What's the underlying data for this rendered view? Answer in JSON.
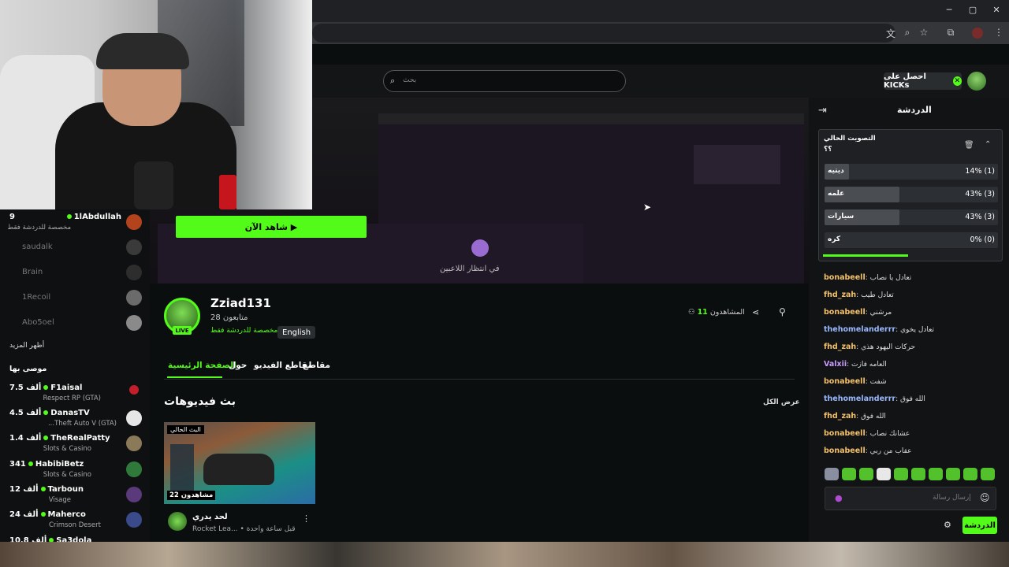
{
  "browser": {
    "min_icon": "─",
    "max_icon": "▢",
    "close_icon": "✕",
    "toolbar_icons": [
      "translate-icon",
      "zoom-icon",
      "star-icon",
      "extensions-icon",
      "menu-icon"
    ]
  },
  "header": {
    "search_placeholder": "بحث",
    "get_kicks": "احصل على KICKs"
  },
  "sidebar": {
    "top_channel": {
      "name": "1lAbdullah",
      "views": "9",
      "category": "مخصصة للدردشة فقط"
    },
    "offline": [
      "saudalk",
      "Brain",
      "1Recoil",
      "Abo5oel"
    ],
    "show_more": "أظهر المزيد",
    "recommended_heading": "موصى بها",
    "recommended": [
      {
        "name": "F1aisal",
        "views": "7.5 ألف",
        "category": "Respect RP (GTA)"
      },
      {
        "name": "DanasTV",
        "views": "4.5 ألف",
        "category": "...Theft Auto V (GTA)"
      },
      {
        "name": "TheRealPatty",
        "views": "1.4 ألف",
        "category": "Slots & Casino"
      },
      {
        "name": "HabibiBetz",
        "views": "341",
        "category": "Slots & Casino"
      },
      {
        "name": "Tarboun",
        "views": "12 ألف",
        "category": "Visage"
      },
      {
        "name": "Maherco",
        "views": "24 ألف",
        "category": "Crimson Desert"
      },
      {
        "name": "Sa3dola",
        "views": "10.8 ألف",
        "category": ""
      }
    ]
  },
  "player": {
    "watch_now": "شاهد الآن ▶",
    "overlay_text": "في انتظار اللاعبين"
  },
  "channel": {
    "name": "Zziad131",
    "followers": "متابعون 28",
    "category": "مخصصة للدردشة فقط",
    "language": "English",
    "live": "LIVE",
    "viewers_label": "المشاهدون",
    "viewers_count": "11"
  },
  "tabs": [
    "الصفحة الرئيسية",
    "حول",
    "مقاطع الفيديو",
    "مقاطع"
  ],
  "vods": {
    "title": "بث فيديوهات",
    "show_all": "عرض الكل",
    "item": {
      "badge": "البث الحالي",
      "views": "مشاهدون 22",
      "title": "لحد يدري",
      "subtitle": "Rocket Lea... • قبل ساعة واحدة"
    }
  },
  "chat": {
    "title": "الدردشة",
    "poll": {
      "title": "التصويت الحالي",
      "question": "؟؟",
      "options": [
        {
          "label": "ديتيه",
          "value": "14% (1)",
          "fill": 0.14
        },
        {
          "label": "علمه",
          "value": "43% (3)",
          "fill": 0.43
        },
        {
          "label": "سيارات",
          "value": "43% (3)",
          "fill": 0.43
        },
        {
          "label": "كره",
          "value": "0% (0)",
          "fill": 0
        }
      ]
    },
    "messages": [
      {
        "user": "bonabeell",
        "color": "#f4c16b",
        "text": "تعادل يا نصاب"
      },
      {
        "user": "fhd_zah",
        "color": "#f4c16b",
        "text": "تعادل طيب"
      },
      {
        "user": "bonabeell",
        "color": "#f4c16b",
        "text": "مرشني"
      },
      {
        "user": "thehomelanderrr",
        "color": "#9ab8ff",
        "text": "تعادل يخوي"
      },
      {
        "user": "fhd_zah",
        "color": "#f4c16b",
        "text": "حركات اليهود هذي"
      },
      {
        "user": "Valxii",
        "color": "#c99bff",
        "text": "العامه فازت"
      },
      {
        "user": "bonabeell",
        "color": "#f4c16b",
        "text": "شفت"
      },
      {
        "user": "thehomelanderrr",
        "color": "#9ab8ff",
        "text": "الله فوق"
      },
      {
        "user": "fhd_zah",
        "color": "#f4c16b",
        "text": "الله فوق"
      },
      {
        "user": "bonabeell",
        "color": "#f4c16b",
        "text": "عشانك نصاب"
      },
      {
        "user": "bonabeell",
        "color": "#f4c16b",
        "text": "عقاب من ربي"
      }
    ],
    "input_placeholder": "إرسال رسالة",
    "send": "الدردشة"
  }
}
